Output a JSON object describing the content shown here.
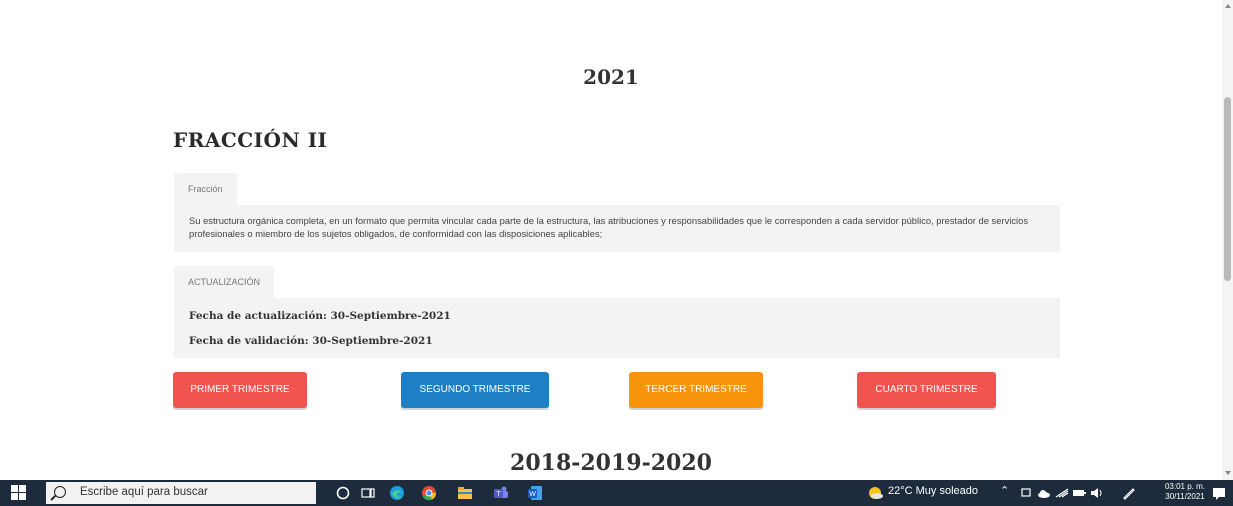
{
  "page": {
    "year_top": "2021",
    "section_title": "FRACCIÓN II",
    "fraccion_tab_label": "Fracción",
    "fraccion_text": "Su estructura orgánica completa, en un formato que permita vincular cada parte de la estructura, las atribuciones y responsabilidades que le corresponden a cada servidor público, prestador de servicios profesionales o miembro de los sujetos obligados, de conformidad con las disposiciones aplicables;",
    "actualizacion_tab_label": "ACTUALIZACIÓN",
    "fecha_actualizacion": "Fecha de actualización: 30-Septiembre-2021",
    "fecha_validacion": "Fecha de validación: 30-Septiembre-2021",
    "buttons": [
      "PRIMER TRIMESTRE",
      "SEGUNDO TRIMESTRE",
      "TERCER TRIMESTRE",
      "CUARTO TRIMESTRE"
    ],
    "button_colors": [
      "#f1534e",
      "#1f7fc4",
      "#f7940c",
      "#f1534e"
    ],
    "year_bottom": "2018-2019-2020"
  },
  "taskbar": {
    "search_placeholder": "Escribe aquí para buscar",
    "weather": "22°C  Muy soleado",
    "time": "03:01 p. m.",
    "date": "30/11/2021",
    "pinned_icons": [
      "cortana-icon",
      "task-view-icon",
      "edge-icon",
      "chrome-icon",
      "file-explorer-icon",
      "teams-icon",
      "word-icon"
    ],
    "tray_icons": [
      "weather-icon",
      "chevron-up-icon",
      "network-icon",
      "onedrive-icon",
      "wifi-icon",
      "battery-icon",
      "volume-icon",
      "pen-icon",
      "notifications-icon"
    ]
  }
}
